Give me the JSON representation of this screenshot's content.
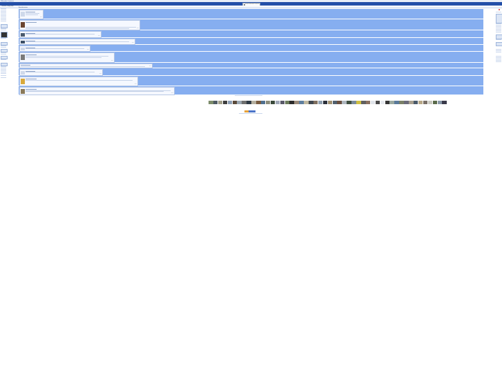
{
  "app": {
    "brand": "Wikimedia Commons",
    "search_placeholder": "Search Wikimedia Commons",
    "subheading": "Commons: Village pump"
  },
  "feed": {
    "heading": "Recent discussions",
    "posts": [
      {
        "meta": "Reply"
      },
      {
        "meta": "Reply"
      },
      {
        "meta": "Reply"
      },
      {
        "meta": "Reply"
      },
      {
        "meta": "Reply"
      },
      {
        "meta": "Reply"
      },
      {
        "meta": "Reply"
      },
      {
        "meta": "Reply"
      },
      {
        "meta": "Reply"
      },
      {
        "meta": "Reply"
      }
    ]
  },
  "colors": {
    "header": "#234fa8",
    "post_background": "#86aef0",
    "card_background": "#f5f8ff",
    "accent_red": "#d33333"
  },
  "icons": [
    "search-icon",
    "notification-icon"
  ]
}
